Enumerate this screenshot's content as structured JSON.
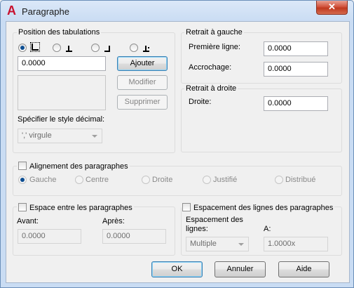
{
  "window": {
    "title": "Paragraphe",
    "app_icon": "autocad-a-icon",
    "close_label": "✕"
  },
  "tabs_group": {
    "label": "Position des tabulations",
    "radios": [
      {
        "icon": "tab-left-icon",
        "checked": true
      },
      {
        "icon": "tab-center-icon",
        "checked": false
      },
      {
        "icon": "tab-right-icon",
        "checked": false
      },
      {
        "icon": "tab-decimal-icon",
        "checked": false
      }
    ],
    "position_value": "0.0000",
    "add_button": "Ajouter",
    "modify_button": "Modifier",
    "delete_button": "Supprimer",
    "decimal_label": "Spécifier le style décimal:",
    "decimal_value": "',' virgule"
  },
  "left_indent": {
    "label": "Retrait à gauche",
    "first_line_label": "Première ligne:",
    "first_line_value": "0.0000",
    "hanging_label": "Accrochage:",
    "hanging_value": "0.0000"
  },
  "right_indent": {
    "label": "Retrait à droite",
    "right_label": "Droite:",
    "right_value": "0.0000"
  },
  "alignment": {
    "label": "Alignement des paragraphes",
    "checked": false,
    "options": [
      "Gauche",
      "Centre",
      "Droite",
      "Justifié",
      "Distribué"
    ],
    "selected": "Gauche"
  },
  "paragraph_spacing": {
    "label": "Espace entre les paragraphes",
    "checked": false,
    "before_label": "Avant:",
    "before_value": "0.0000",
    "after_label": "Après:",
    "after_value": "0.0000"
  },
  "line_spacing": {
    "label": "Espacement des lignes des paragraphes",
    "checked": false,
    "spacing_label_1": "Espacement des",
    "spacing_label_2": "lignes:",
    "spacing_value": "Multiple",
    "at_label": "A:",
    "at_value": "1.0000x"
  },
  "buttons": {
    "ok": "OK",
    "cancel": "Annuler",
    "help": "Aide"
  }
}
